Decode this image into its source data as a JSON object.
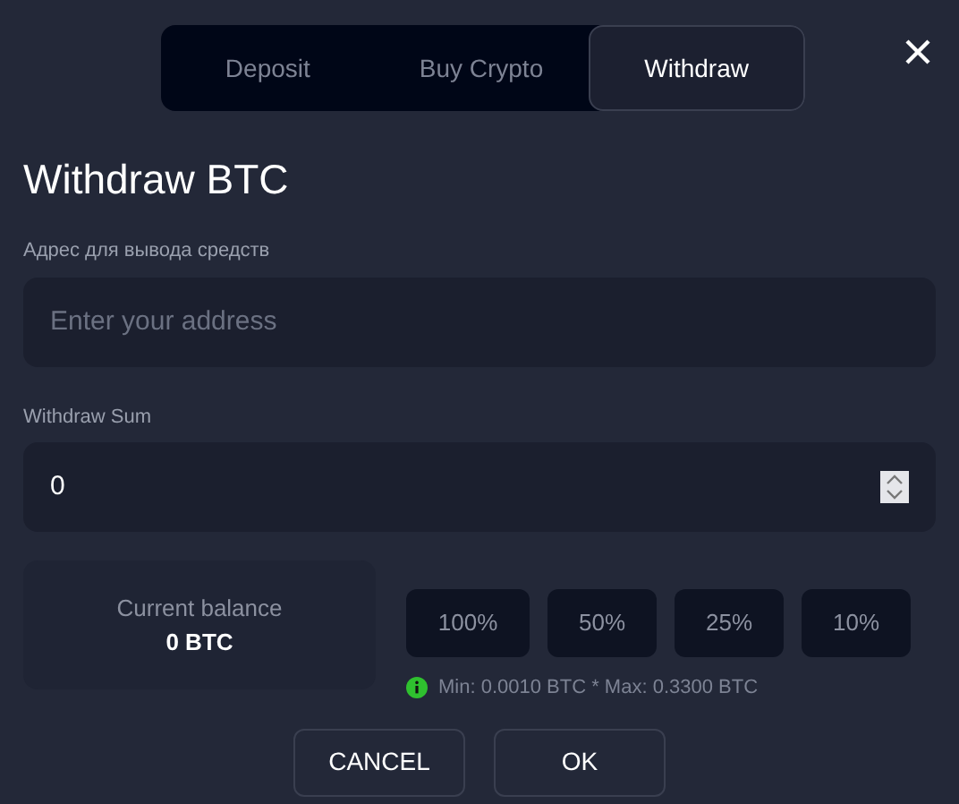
{
  "tabs": [
    {
      "label": "Deposit",
      "selected": false
    },
    {
      "label": "Buy Crypto",
      "selected": false
    },
    {
      "label": "Withdraw",
      "selected": true
    }
  ],
  "title": "Withdraw BTC",
  "address": {
    "label": "Адрес для вывода средств",
    "placeholder": "Enter your address"
  },
  "sum": {
    "label": "Withdraw Sum",
    "value": "0"
  },
  "balance": {
    "label": "Current balance",
    "value": "0 BTC"
  },
  "percents": [
    "100%",
    "50%",
    "25%",
    "10%"
  ],
  "limits": "Min: 0.0010 BTC * Max: 0.3300 BTC",
  "buttons": [
    "CANCEL",
    "OK"
  ]
}
